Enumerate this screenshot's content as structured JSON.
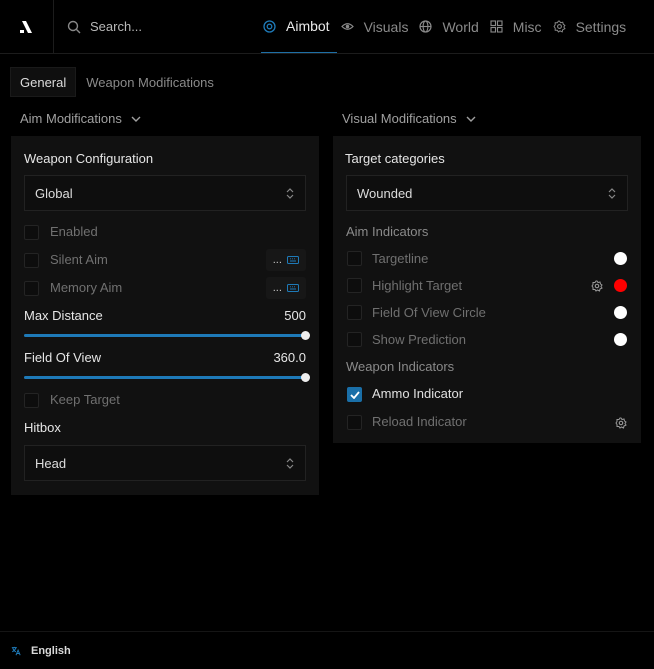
{
  "logo": {
    "icon": "brand-slash-logo"
  },
  "search": {
    "placeholder": "Search...",
    "value": ""
  },
  "nav": {
    "tabs": [
      {
        "label": "Aimbot",
        "icon": "target-icon",
        "active": true
      },
      {
        "label": "Visuals",
        "icon": "eye-icon",
        "active": false
      },
      {
        "label": "World",
        "icon": "globe-icon",
        "active": false
      },
      {
        "label": "Misc",
        "icon": "grid-icon",
        "active": false
      },
      {
        "label": "Settings",
        "icon": "gear-icon",
        "active": false
      }
    ]
  },
  "subtabs": [
    {
      "label": "General",
      "active": true
    },
    {
      "label": "Weapon Modifications",
      "active": false
    }
  ],
  "aim": {
    "header": "Aim Modifications",
    "weapon_config_label": "Weapon Configuration",
    "weapon_config_value": "Global",
    "enabled": {
      "label": "Enabled",
      "checked": false
    },
    "silent_aim": {
      "label": "Silent Aim",
      "checked": false,
      "keybind": "..."
    },
    "memory_aim": {
      "label": "Memory Aim",
      "checked": false,
      "keybind": "..."
    },
    "max_distance": {
      "label": "Max Distance",
      "value": "500",
      "fraction": 1.0
    },
    "field_of_view": {
      "label": "Field Of View",
      "value": "360.0",
      "fraction": 1.0
    },
    "keep_target": {
      "label": "Keep Target",
      "checked": false
    },
    "hitbox_label": "Hitbox",
    "hitbox_value": "Head"
  },
  "visual": {
    "header": "Visual Modifications",
    "target_categories_label": "Target categories",
    "target_categories_value": "Wounded",
    "aim_indicators_label": "Aim Indicators",
    "targetline": {
      "label": "Targetline",
      "checked": false,
      "color": "#ffffff"
    },
    "highlight_target": {
      "label": "Highlight Target",
      "checked": false,
      "color": "#ff0000"
    },
    "fov_circle": {
      "label": "Field Of View Circle",
      "checked": false,
      "color": "#ffffff"
    },
    "show_prediction": {
      "label": "Show Prediction",
      "checked": false,
      "color": "#ffffff"
    },
    "weapon_indicators_label": "Weapon Indicators",
    "ammo_indicator": {
      "label": "Ammo Indicator",
      "checked": true
    },
    "reload_indicator": {
      "label": "Reload Indicator",
      "checked": false
    }
  },
  "footer": {
    "language": "English",
    "icon": "translate-icon"
  },
  "colors": {
    "accent": "#1e7ab8",
    "background": "#000000",
    "panel": "#111111"
  }
}
